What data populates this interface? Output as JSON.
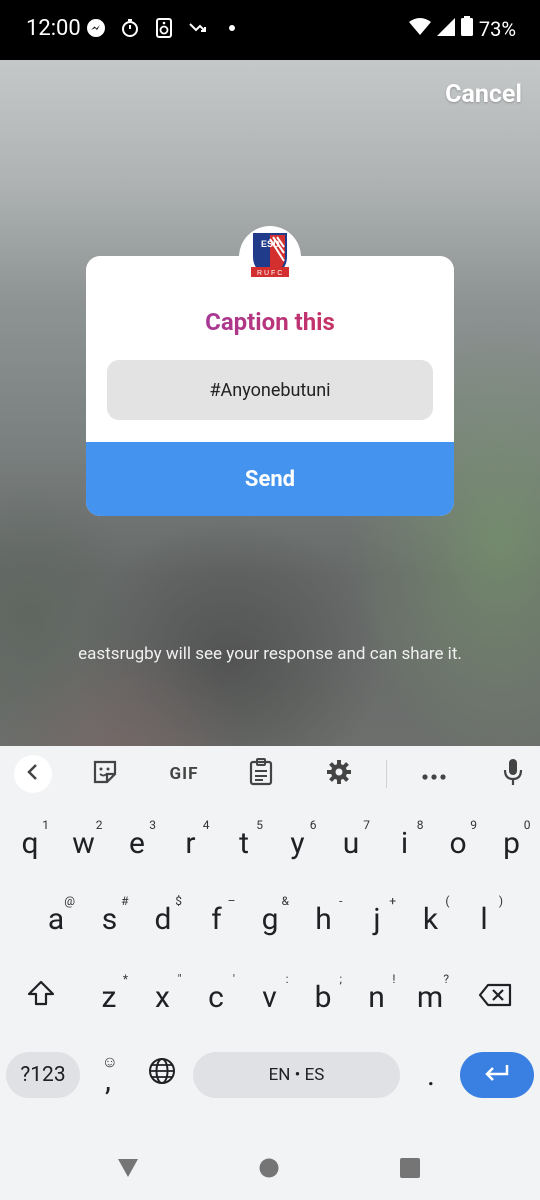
{
  "status_bar": {
    "time": "12:00",
    "battery": "73%",
    "left_icons": [
      "messenger-icon",
      "timer-icon",
      "speaker-icon",
      "missed-call-icon",
      "dot-icon"
    ],
    "right_icons": [
      "wifi-icon",
      "signal-icon",
      "battery-icon"
    ]
  },
  "story": {
    "cancel_label": "Cancel",
    "card": {
      "title": "Caption this",
      "input_value": "#Anyonebutuni",
      "send_label": "Send",
      "avatar_icon": "club-crest-icon"
    },
    "notice": "eastsrugby will see your response and can share it."
  },
  "keyboard": {
    "toolbar": {
      "gif_label": "GIF",
      "icons": [
        "chevron-left-icon",
        "sticker-icon",
        "clipboard-icon",
        "settings-icon",
        "more-icon",
        "mic-icon"
      ]
    },
    "row1": [
      {
        "k": "q",
        "h": "1"
      },
      {
        "k": "w",
        "h": "2"
      },
      {
        "k": "e",
        "h": "3"
      },
      {
        "k": "r",
        "h": "4"
      },
      {
        "k": "t",
        "h": "5"
      },
      {
        "k": "y",
        "h": "6"
      },
      {
        "k": "u",
        "h": "7"
      },
      {
        "k": "i",
        "h": "8"
      },
      {
        "k": "o",
        "h": "9"
      },
      {
        "k": "p",
        "h": "0"
      }
    ],
    "row2": [
      {
        "k": "a",
        "h": "@"
      },
      {
        "k": "s",
        "h": "#"
      },
      {
        "k": "d",
        "h": "$"
      },
      {
        "k": "f",
        "h": "–"
      },
      {
        "k": "g",
        "h": "&"
      },
      {
        "k": "h",
        "h": "-"
      },
      {
        "k": "j",
        "h": "+"
      },
      {
        "k": "k",
        "h": "("
      },
      {
        "k": "l",
        "h": ")"
      }
    ],
    "row3": [
      {
        "k": "z",
        "h": "*"
      },
      {
        "k": "x",
        "h": "\""
      },
      {
        "k": "c",
        "h": "'"
      },
      {
        "k": "v",
        "h": ":"
      },
      {
        "k": "b",
        "h": ";"
      },
      {
        "k": "n",
        "h": "!"
      },
      {
        "k": "m",
        "h": "?"
      }
    ],
    "symbols_label": "?123",
    "comma_label": ",",
    "emoji_hint": "☺",
    "space_label": "EN • ES",
    "period_label": ".",
    "shift_icon": "shift-icon",
    "backspace_icon": "backspace-icon",
    "globe_icon": "globe-icon",
    "enter_icon": "enter-icon"
  },
  "navbar": {
    "icons": [
      "back-triangle-icon",
      "home-circle-icon",
      "recents-square-icon"
    ]
  }
}
